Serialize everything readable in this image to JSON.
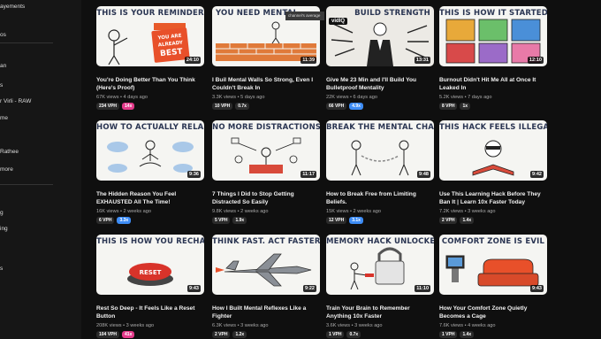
{
  "sidebar": {
    "items": [
      {
        "label": "ayements"
      },
      {
        "label": "os"
      },
      {
        "label": "an"
      },
      {
        "label": "s"
      },
      {
        "label": "r Virli - RAW"
      },
      {
        "label": "me"
      },
      {
        "label": "Rathee"
      },
      {
        "label": "more"
      },
      {
        "label": "g"
      },
      {
        "label": "ing"
      },
      {
        "label": "s"
      }
    ]
  },
  "overlay": {
    "tooltip": "channel's average",
    "vidiq": "vidIQ"
  },
  "videos": [
    {
      "thumb_title": "THIS IS YOUR REMINDER",
      "duration": "24:10",
      "title": "You're Doing Better Than You Think (Here's Proof)",
      "meta": "67K views • 4 days ago",
      "vph": "234 VPH",
      "mult": "14x",
      "mult_color": "pink"
    },
    {
      "thumb_title": "YOU NEED MENTAL",
      "duration": "11:39",
      "title": "I Buil Mental Walls So Strong, Even I Couldn't Break In",
      "meta": "3.3K views • 5 days ago",
      "vph": "10 VPH",
      "mult": "0.7x",
      "mult_color": "dark"
    },
    {
      "thumb_title": "BUILD STRENGTH",
      "duration": "13:31",
      "title": "Give Me 23 Min and I'll Build You Bulletproof Mentality",
      "meta": "22K views • 6 days ago",
      "vph": "66 VPH",
      "mult": "4.9x",
      "mult_color": "blue"
    },
    {
      "thumb_title": "THIS IS HOW IT STARTED",
      "duration": "12:10",
      "title": "Burnout Didn't Hit Me All at Once It Leaked In",
      "meta": "5.2K views • 7 days ago",
      "vph": "8 VPH",
      "mult": "1x",
      "mult_color": "dark"
    },
    {
      "thumb_title": "HOW TO ACTUALLY RELAX",
      "duration": "9:36",
      "title": "The Hidden Reason You Feel EXHAUSTED All The Time!",
      "meta": "16K views • 2 weeks ago",
      "vph": "6 VPH",
      "mult": "3.3x",
      "mult_color": "blue"
    },
    {
      "thumb_title": "NO MORE DISTRACTIONS",
      "duration": "11:17",
      "title": "7 Things I Did to Stop Getting Distracted So Easily",
      "meta": "9.8K views • 2 weeks ago",
      "vph": "5 VPH",
      "mult": "1.9x",
      "mult_color": "dark"
    },
    {
      "thumb_title": "BREAK THE MENTAL CHAINS",
      "duration": "9:48",
      "title": "How to Break Free from Limiting Beliefs.",
      "meta": "15K views • 2 weeks ago",
      "vph": "12 VPH",
      "mult": "3.1x",
      "mult_color": "blue"
    },
    {
      "thumb_title": "THIS HACK FEELS ILLEGAL",
      "duration": "9:42",
      "title": "Use This Learning Hack Before They Ban It | Learn 10x Faster Today",
      "meta": "7.2K views • 3 weeks ago",
      "vph": "2 VPH",
      "mult": "1.4x",
      "mult_color": "dark"
    },
    {
      "thumb_title": "THIS IS HOW YOU RECHARGE",
      "duration": "9:43",
      "title": "Rest So Deep - It Feels Like a Reset Button",
      "meta": "208K views • 3 weeks ago",
      "vph": "104 VPH",
      "mult": "41x",
      "mult_color": "pink"
    },
    {
      "thumb_title": "THINK FAST. ACT FASTER",
      "duration": "9:22",
      "title": "How I Built Mental Reflexes Like a Fighter",
      "meta": "6.3K views • 3 weeks ago",
      "vph": "2 VPH",
      "mult": "1.2x",
      "mult_color": "dark"
    },
    {
      "thumb_title": "MEMORY HACK UNLOCKED",
      "duration": "11:10",
      "title": "Train Your Brain to Remember Anything 10x Faster",
      "meta": "3.6K views • 3 weeks ago",
      "vph": "1 VPH",
      "mult": "0.7x",
      "mult_color": "dark"
    },
    {
      "thumb_title": "COMFORT ZONE IS EVIL",
      "duration": "9:43",
      "title": "How Your Comfort Zone Quietly Becomes a Cage",
      "meta": "7.6K views • 4 weeks ago",
      "vph": "1 VPH",
      "mult": "1.4x",
      "mult_color": "dark"
    }
  ],
  "thumb_text": {
    "sign": [
      "YOU ARE",
      "ALREADY",
      "BEST"
    ],
    "button": "RESET"
  }
}
